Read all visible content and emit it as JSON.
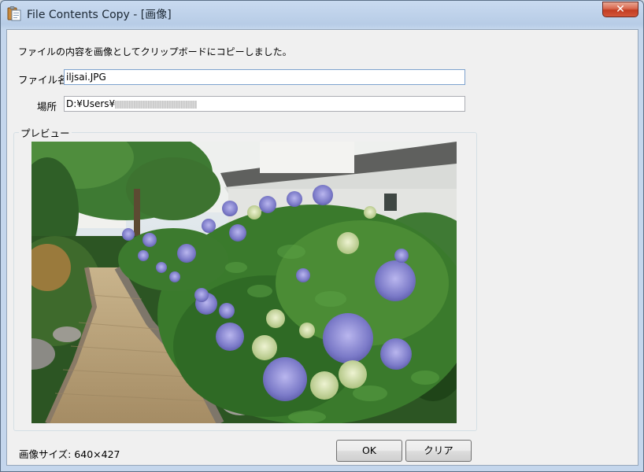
{
  "window": {
    "title": "File Contents Copy - [画像]",
    "close_label": "✕"
  },
  "message": "ファイルの内容を画像としてクリップボードにコピーしました。",
  "file": {
    "name_label": "ファイル名",
    "name_value": "iljsai.JPG",
    "location_label": "場所",
    "location_value": "D:¥Users¥"
  },
  "preview": {
    "label": "プレビュー"
  },
  "status": {
    "image_size": "画像サイズ: 640×427"
  },
  "buttons": {
    "ok": "OK",
    "clear": "クリア"
  },
  "colors": {
    "titlebar": "#b7cce6",
    "close": "#c23d22",
    "client": "#f0f0f0"
  }
}
